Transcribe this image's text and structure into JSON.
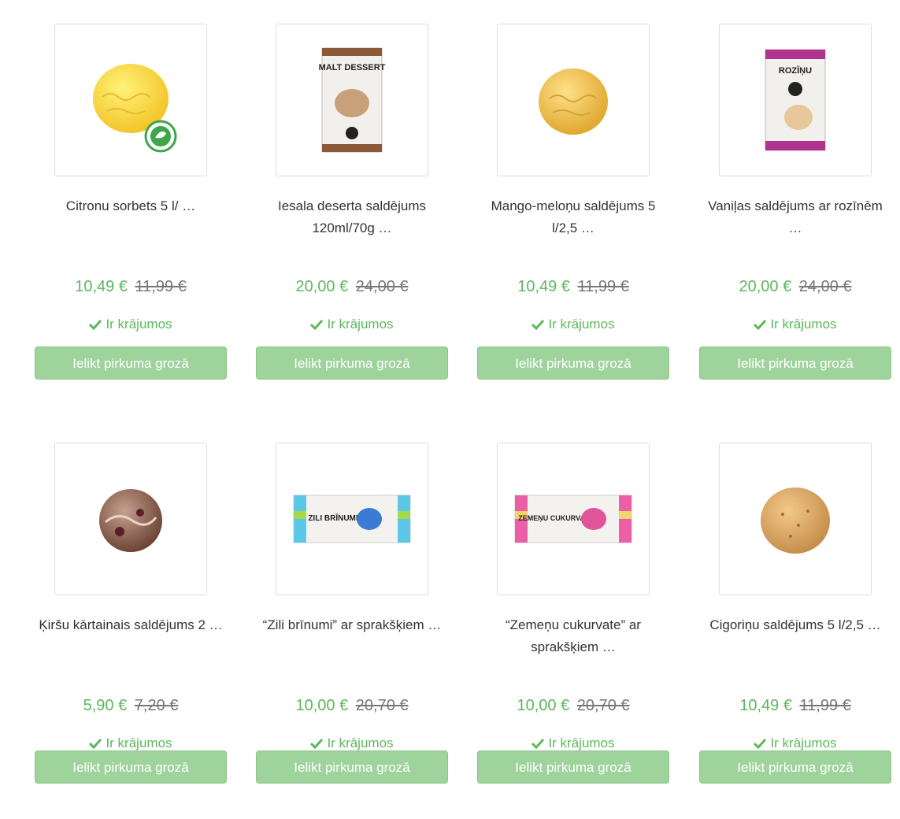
{
  "products": [
    {
      "title": "Citronu sorbets 5 l/ …",
      "price": "10,49 €",
      "old_price": "11,99 €",
      "stock": "Ir krājumos",
      "button": "Ielikt pirkuma grozā",
      "image_icon": "lemon-sorbet-scoop-icon"
    },
    {
      "title": "Iesala deserta saldējums 120ml/70g …",
      "price": "20,00 €",
      "old_price": "24,00 €",
      "stock": "Ir krājumos",
      "button": "Ielikt pirkuma grozā",
      "image_icon": "malt-dessert-package-icon",
      "image_text": "MALT DESSERT"
    },
    {
      "title": "Mango-meloņu saldējums 5 l/2,5 …",
      "price": "10,49 €",
      "old_price": "11,99 €",
      "stock": "Ir krājumos",
      "button": "Ielikt pirkuma grozā",
      "image_icon": "mango-scoop-icon"
    },
    {
      "title": "Vaniļas saldējums ar rozīnēm …",
      "price": "20,00 €",
      "old_price": "24,00 €",
      "stock": "Ir krājumos",
      "button": "Ielikt pirkuma grozā",
      "image_icon": "raisin-package-icon",
      "image_text": "ROZĪŅU"
    },
    {
      "title": "Ķiršu kārtainais saldējums 2 …",
      "price": "5,90 €",
      "old_price": "7,20 €",
      "stock": "Ir krājumos",
      "button": "Ielikt pirkuma grozā",
      "image_icon": "cherry-scoop-icon"
    },
    {
      "title": "“Zili brīnumi” ar sprakšķiem …",
      "price": "10,00 €",
      "old_price": "20,70 €",
      "stock": "Ir krājumos",
      "button": "Ielikt pirkuma grozā",
      "image_icon": "zili-brinumi-wrapper-icon",
      "image_text": "ZILI BRĪNUMI"
    },
    {
      "title": "“Zemeņu cukurvate” ar sprakšķiem …",
      "price": "10,00 €",
      "old_price": "20,70 €",
      "stock": "Ir krājumos",
      "button": "Ielikt pirkuma grozā",
      "image_icon": "zemenu-cukurvate-wrapper-icon",
      "image_text": "ZEMEŅU CUKURVATE"
    },
    {
      "title": "Cigoriņu saldējums 5 l/2,5 …",
      "price": "10,49 €",
      "old_price": "11,99 €",
      "stock": "Ir krājumos",
      "button": "Ielikt pirkuma grozā",
      "image_icon": "chicory-scoop-icon"
    }
  ],
  "colors": {
    "price_green": "#5cb85c",
    "button_bg": "#9fd39c",
    "old_price": "#777777"
  }
}
